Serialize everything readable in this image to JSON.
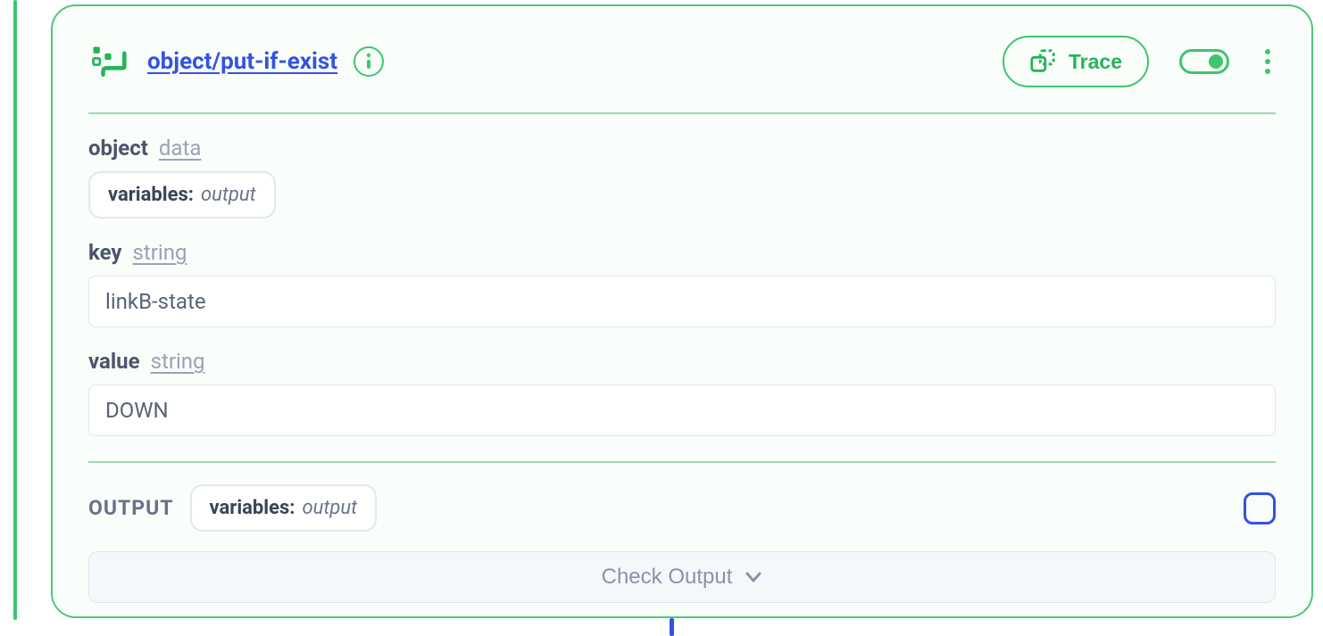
{
  "node": {
    "title": "object/put-if-exist",
    "trace_label": "Trace"
  },
  "fields": {
    "object": {
      "name": "object",
      "type": "data",
      "chip_key": "variables:",
      "chip_val": "output"
    },
    "key": {
      "name": "key",
      "type": "string",
      "value": "linkB-state"
    },
    "value": {
      "name": "value",
      "type": "string",
      "value": "DOWN"
    }
  },
  "output": {
    "label": "OUTPUT",
    "chip_key": "variables:",
    "chip_val": "output",
    "check_label": "Check Output"
  }
}
